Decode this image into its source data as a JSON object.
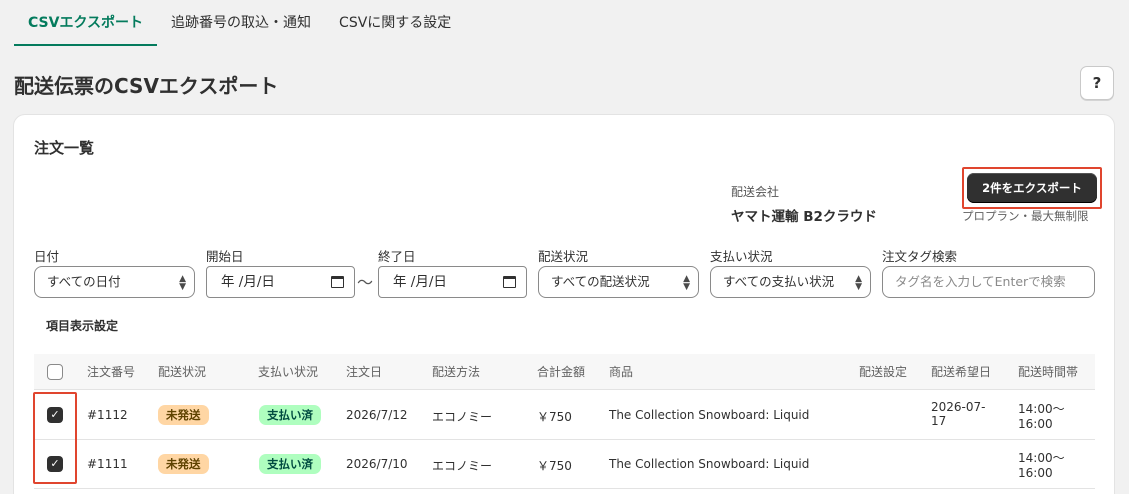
{
  "tabs": [
    {
      "label": "CSVエクスポート"
    },
    {
      "label": "追跡番号の取込・通知"
    },
    {
      "label": "CSVに関する設定"
    }
  ],
  "page_title": "配送伝票のCSVエクスポート",
  "help_label": "?",
  "card_title": "注文一覧",
  "carrier": {
    "label": "配送会社",
    "name": "ヤマト運輸 B2クラウド"
  },
  "export": {
    "button": "2件をエクスポート",
    "plan_note": "プロプラン・最大無制限"
  },
  "filters": {
    "date": {
      "label": "日付",
      "value": "すべての日付"
    },
    "start": {
      "label": "開始日",
      "value": "年 /月/日"
    },
    "tilde": "〜",
    "end": {
      "label": "終了日",
      "value": "年 /月/日"
    },
    "ship_status": {
      "label": "配送状況",
      "value": "すべての配送状況"
    },
    "pay_status": {
      "label": "支払い状況",
      "value": "すべての支払い状況"
    },
    "tag_search": {
      "label": "注文タグ検索",
      "placeholder": "タグ名を入力してEnterで検索"
    }
  },
  "column_settings": "項目表示設定",
  "columns": [
    "注文番号",
    "配送状況",
    "支払い状況",
    "注文日",
    "配送方法",
    "合計金額",
    "商品",
    "配送設定",
    "配送希望日",
    "配送時間帯"
  ],
  "orders": [
    {
      "id": "#1112",
      "ship": "未発送",
      "pay": "支払い済",
      "date": "2026/7/12",
      "method": "エコノミー",
      "total": "￥750",
      "product": "The Collection Snowboard: Liquid",
      "setting": "",
      "wish_date_1": "2026-07-",
      "wish_date_2": "17",
      "time_1": "14:00〜",
      "time_2": "16:00",
      "checked": true
    },
    {
      "id": "#1111",
      "ship": "未発送",
      "pay": "支払い済",
      "date": "2026/7/10",
      "method": "エコノミー",
      "total": "￥750",
      "product": "The Collection Snowboard: Liquid",
      "setting": "",
      "wish_date_1": "",
      "wish_date_2": "",
      "time_1": "14:00〜",
      "time_2": "16:00",
      "checked": true
    }
  ],
  "colors": {
    "accent": "#047b5d",
    "highlight": "#e0452e",
    "unshipped_badge": "#ffd6a4",
    "paid_badge": "#affebf",
    "primary_button": "#303030"
  }
}
